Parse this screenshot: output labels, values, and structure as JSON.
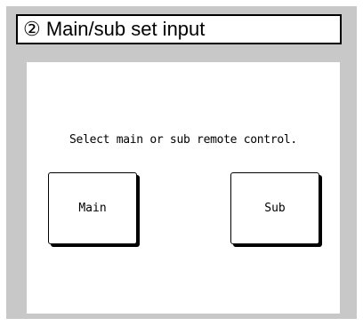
{
  "header": {
    "title": "② Main/sub set input"
  },
  "screen": {
    "prompt": "Select main or sub remote control.",
    "buttons": {
      "main_label": "Main",
      "sub_label": "Sub"
    }
  },
  "colors": {
    "frame_background": "#c8c8c8",
    "screen_background": "#ffffff",
    "text": "#000000"
  }
}
